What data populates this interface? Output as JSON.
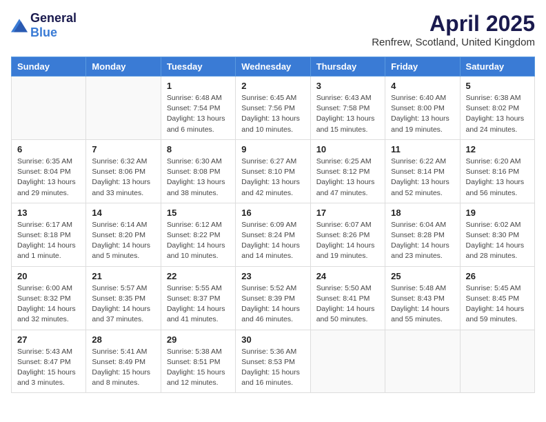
{
  "header": {
    "logo_general": "General",
    "logo_blue": "Blue",
    "title": "April 2025",
    "subtitle": "Renfrew, Scotland, United Kingdom"
  },
  "days_of_week": [
    "Sunday",
    "Monday",
    "Tuesday",
    "Wednesday",
    "Thursday",
    "Friday",
    "Saturday"
  ],
  "weeks": [
    [
      {
        "day": "",
        "info": ""
      },
      {
        "day": "",
        "info": ""
      },
      {
        "day": "1",
        "info": "Sunrise: 6:48 AM\nSunset: 7:54 PM\nDaylight: 13 hours and 6 minutes."
      },
      {
        "day": "2",
        "info": "Sunrise: 6:45 AM\nSunset: 7:56 PM\nDaylight: 13 hours and 10 minutes."
      },
      {
        "day": "3",
        "info": "Sunrise: 6:43 AM\nSunset: 7:58 PM\nDaylight: 13 hours and 15 minutes."
      },
      {
        "day": "4",
        "info": "Sunrise: 6:40 AM\nSunset: 8:00 PM\nDaylight: 13 hours and 19 minutes."
      },
      {
        "day": "5",
        "info": "Sunrise: 6:38 AM\nSunset: 8:02 PM\nDaylight: 13 hours and 24 minutes."
      }
    ],
    [
      {
        "day": "6",
        "info": "Sunrise: 6:35 AM\nSunset: 8:04 PM\nDaylight: 13 hours and 29 minutes."
      },
      {
        "day": "7",
        "info": "Sunrise: 6:32 AM\nSunset: 8:06 PM\nDaylight: 13 hours and 33 minutes."
      },
      {
        "day": "8",
        "info": "Sunrise: 6:30 AM\nSunset: 8:08 PM\nDaylight: 13 hours and 38 minutes."
      },
      {
        "day": "9",
        "info": "Sunrise: 6:27 AM\nSunset: 8:10 PM\nDaylight: 13 hours and 42 minutes."
      },
      {
        "day": "10",
        "info": "Sunrise: 6:25 AM\nSunset: 8:12 PM\nDaylight: 13 hours and 47 minutes."
      },
      {
        "day": "11",
        "info": "Sunrise: 6:22 AM\nSunset: 8:14 PM\nDaylight: 13 hours and 52 minutes."
      },
      {
        "day": "12",
        "info": "Sunrise: 6:20 AM\nSunset: 8:16 PM\nDaylight: 13 hours and 56 minutes."
      }
    ],
    [
      {
        "day": "13",
        "info": "Sunrise: 6:17 AM\nSunset: 8:18 PM\nDaylight: 14 hours and 1 minute."
      },
      {
        "day": "14",
        "info": "Sunrise: 6:14 AM\nSunset: 8:20 PM\nDaylight: 14 hours and 5 minutes."
      },
      {
        "day": "15",
        "info": "Sunrise: 6:12 AM\nSunset: 8:22 PM\nDaylight: 14 hours and 10 minutes."
      },
      {
        "day": "16",
        "info": "Sunrise: 6:09 AM\nSunset: 8:24 PM\nDaylight: 14 hours and 14 minutes."
      },
      {
        "day": "17",
        "info": "Sunrise: 6:07 AM\nSunset: 8:26 PM\nDaylight: 14 hours and 19 minutes."
      },
      {
        "day": "18",
        "info": "Sunrise: 6:04 AM\nSunset: 8:28 PM\nDaylight: 14 hours and 23 minutes."
      },
      {
        "day": "19",
        "info": "Sunrise: 6:02 AM\nSunset: 8:30 PM\nDaylight: 14 hours and 28 minutes."
      }
    ],
    [
      {
        "day": "20",
        "info": "Sunrise: 6:00 AM\nSunset: 8:32 PM\nDaylight: 14 hours and 32 minutes."
      },
      {
        "day": "21",
        "info": "Sunrise: 5:57 AM\nSunset: 8:35 PM\nDaylight: 14 hours and 37 minutes."
      },
      {
        "day": "22",
        "info": "Sunrise: 5:55 AM\nSunset: 8:37 PM\nDaylight: 14 hours and 41 minutes."
      },
      {
        "day": "23",
        "info": "Sunrise: 5:52 AM\nSunset: 8:39 PM\nDaylight: 14 hours and 46 minutes."
      },
      {
        "day": "24",
        "info": "Sunrise: 5:50 AM\nSunset: 8:41 PM\nDaylight: 14 hours and 50 minutes."
      },
      {
        "day": "25",
        "info": "Sunrise: 5:48 AM\nSunset: 8:43 PM\nDaylight: 14 hours and 55 minutes."
      },
      {
        "day": "26",
        "info": "Sunrise: 5:45 AM\nSunset: 8:45 PM\nDaylight: 14 hours and 59 minutes."
      }
    ],
    [
      {
        "day": "27",
        "info": "Sunrise: 5:43 AM\nSunset: 8:47 PM\nDaylight: 15 hours and 3 minutes."
      },
      {
        "day": "28",
        "info": "Sunrise: 5:41 AM\nSunset: 8:49 PM\nDaylight: 15 hours and 8 minutes."
      },
      {
        "day": "29",
        "info": "Sunrise: 5:38 AM\nSunset: 8:51 PM\nDaylight: 15 hours and 12 minutes."
      },
      {
        "day": "30",
        "info": "Sunrise: 5:36 AM\nSunset: 8:53 PM\nDaylight: 15 hours and 16 minutes."
      },
      {
        "day": "",
        "info": ""
      },
      {
        "day": "",
        "info": ""
      },
      {
        "day": "",
        "info": ""
      }
    ]
  ]
}
